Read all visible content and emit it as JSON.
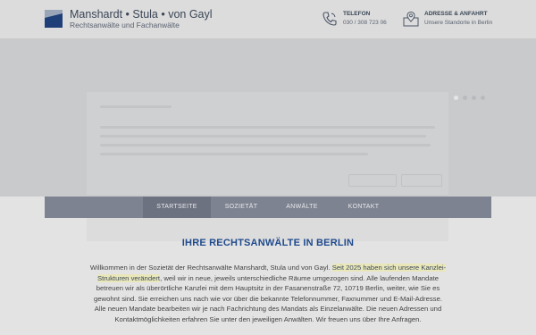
{
  "brand": {
    "title": "Manshardt • Stula • von Gayl",
    "subtitle": "Rechtsanwälte und Fachanwälte",
    "colors": {
      "logo_dark": "#1f3f78",
      "logo_light": "#9aa6b8"
    }
  },
  "contact": {
    "phone": {
      "icon": "phone-icon",
      "label": "TELEFON",
      "value": "030 / 308 723 06"
    },
    "address": {
      "icon": "map-icon",
      "label": "ADRESSE & ANFAHRT",
      "value": "Unsere Standorte in Berlin"
    }
  },
  "slider": {
    "dot_count": 4,
    "active_index": 0
  },
  "nav": {
    "items": [
      {
        "label": "STARTSEITE",
        "active": true
      },
      {
        "label": "SOZIETÄT",
        "active": false
      },
      {
        "label": "ANWÄLTE",
        "active": false
      },
      {
        "label": "KONTAKT",
        "active": false
      }
    ]
  },
  "main": {
    "heading": "IHRE RECHTSANWÄLTE IN BERLIN",
    "para_before": "Willkommen in der Sozietät der Rechtsanwälte Manshardt, Stula und von Gayl.",
    "para_highlight": "Seit 2025 haben sich unsere Kanzlei-Strukturen verändert",
    "para_after": ", weil wir in neue, jeweils unterschiedliche Räume umgezogen sind. Alle laufenden Mandate betreuen wir als überörtliche Kanzlei mit dem Hauptsitz in der Fasanenstraße 72, 10719 Berlin, weiter, wie Sie es gewohnt sind. Sie erreichen uns nach wie vor über die bekannte Telefonnummer, Faxnummer und E-Mail-Adresse. Alle neuen Mandate bearbeiten wir je nach Fachrichtung des Mandats als Einzelanwälte. Die neuen Adressen und Kontaktmöglichkeiten erfahren Sie unter den jeweiligen Anwälten. Wir freuen uns über Ihre Anfragen."
  }
}
